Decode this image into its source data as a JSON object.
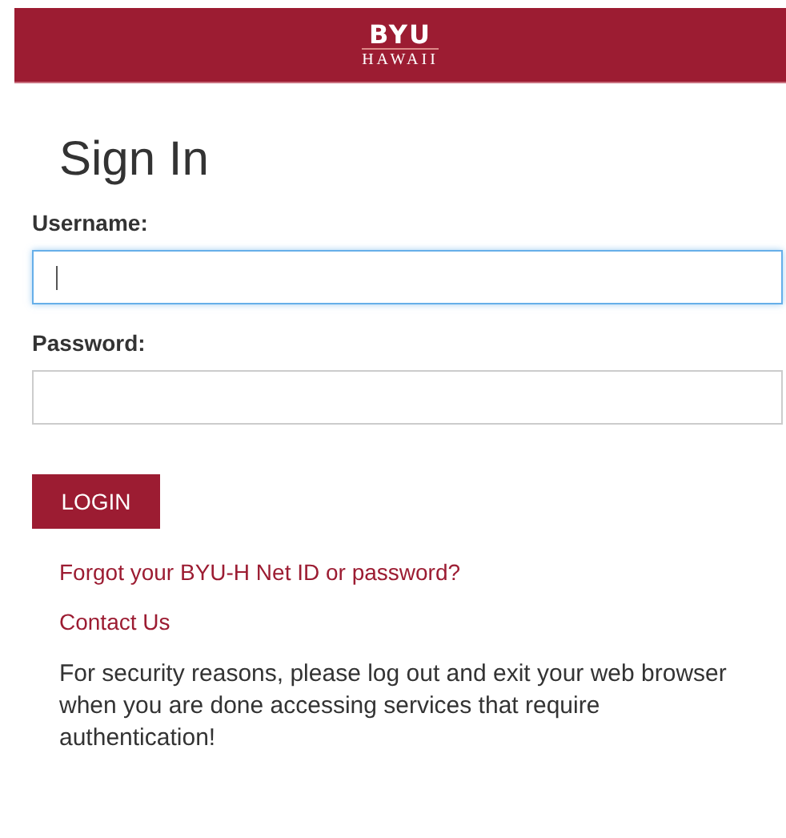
{
  "header": {
    "logo_top": "BYU",
    "logo_bottom": "HAWAII"
  },
  "title": "Sign In",
  "fields": [
    {
      "label": "Username:",
      "focused": true
    },
    {
      "label": "Password:",
      "focused": false
    }
  ],
  "login_button": "LOGIN",
  "links": [
    "Forgot your BYU-H Net ID or password?",
    "Contact Us"
  ],
  "notice": "For security reasons, please log out and exit your web browser when you are done accessing services that require authentication!"
}
